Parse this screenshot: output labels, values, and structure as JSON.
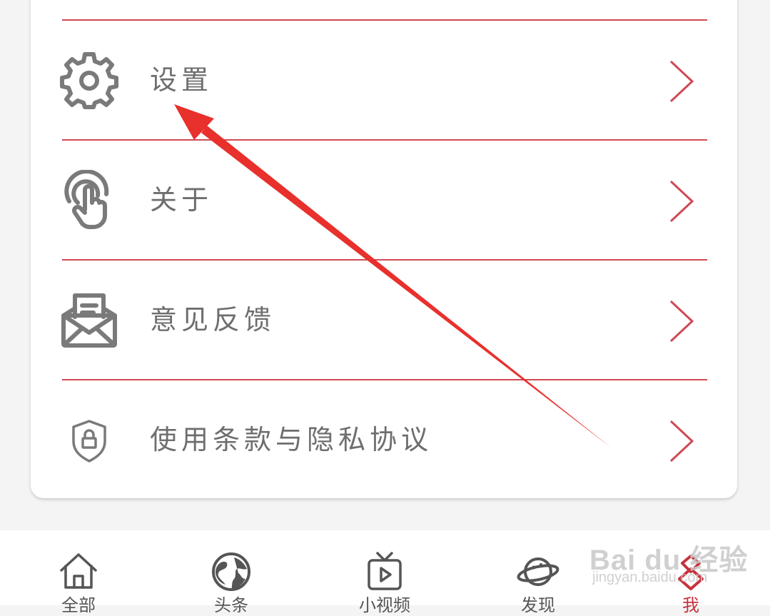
{
  "menu": {
    "items": [
      {
        "label": "设置",
        "icon": "gear-icon"
      },
      {
        "label": "关于",
        "icon": "touch-hand-icon"
      },
      {
        "label": "意见反馈",
        "icon": "mail-feedback-icon"
      },
      {
        "label": "使用条款与隐私协议",
        "icon": "shield-lock-icon"
      }
    ],
    "chevron_icon": "chevron-right-icon"
  },
  "tabbar": {
    "items": [
      {
        "label": "全部",
        "icon": "home-icon"
      },
      {
        "label": "头条",
        "icon": "globe-icon"
      },
      {
        "label": "小视频",
        "icon": "tv-play-icon"
      },
      {
        "label": "发现",
        "icon": "planet-icon"
      },
      {
        "label": "我",
        "icon": "profile-icon",
        "active": true
      }
    ]
  },
  "watermark": {
    "brand": "Bai du 经验",
    "sub": "jingyan.baidu.com"
  },
  "colors": {
    "accent": "#cf4a55",
    "active": "#c8323c",
    "icon_gray": "#7a7a7a",
    "text_gray": "#6e6e6e",
    "annotation_arrow": "#e8302c"
  }
}
